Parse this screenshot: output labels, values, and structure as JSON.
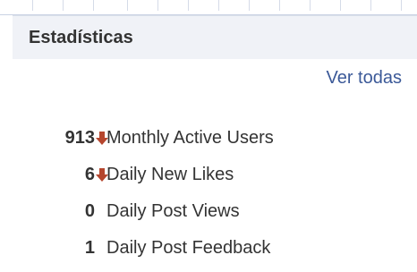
{
  "panel": {
    "title": "Estadísticas",
    "see_all_label": "Ver todas"
  },
  "stats": [
    {
      "value": "913",
      "label": "Monthly Active Users",
      "trend": "down"
    },
    {
      "value": "6",
      "label": "Daily New Likes",
      "trend": "down"
    },
    {
      "value": "0",
      "label": "Daily Post Views",
      "trend": "none"
    },
    {
      "value": "1",
      "label": "Daily Post Feedback",
      "trend": "none"
    }
  ],
  "colors": {
    "header_bg": "#f0f2f7",
    "link": "#3b5998",
    "text": "#333333",
    "trend_down": "#b5462e"
  }
}
